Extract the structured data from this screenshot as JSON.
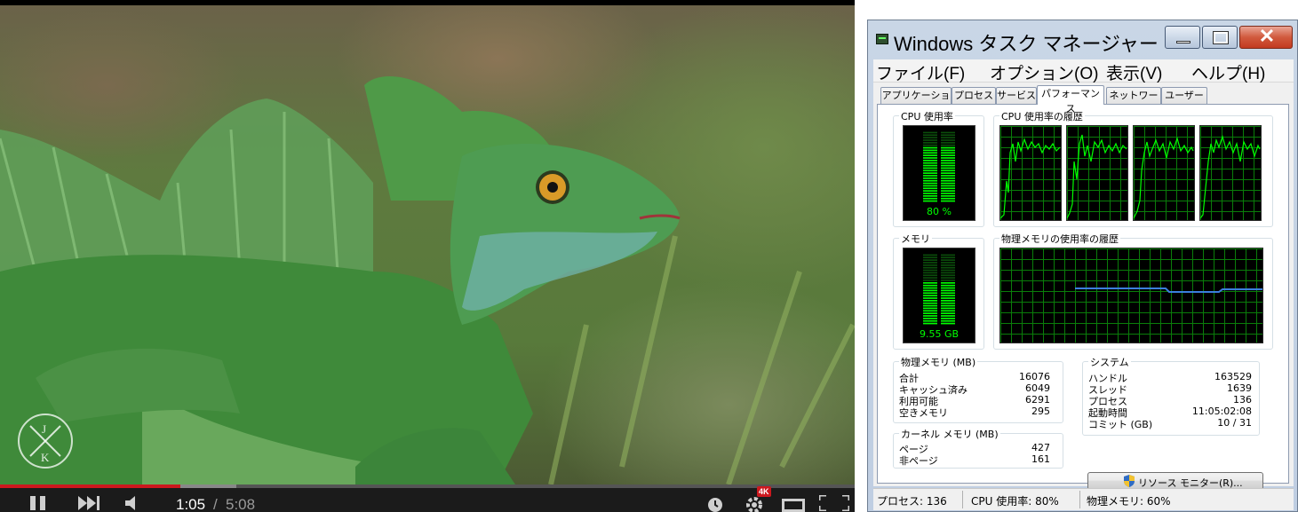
{
  "player": {
    "time_current": "1:05",
    "time_separator": "/",
    "time_total": "5:08",
    "played_fraction": 0.211,
    "buffered_fraction": 0.277,
    "hd_badge": "4K",
    "watermark_letters": "J K",
    "icons": [
      "play-pause-icon",
      "next-icon",
      "volume-icon",
      "watch-later-icon",
      "settings-gear-icon",
      "theater-mode-icon",
      "fullscreen-icon"
    ],
    "colors": {
      "progress": "#cc181e",
      "bar": "#1b1b1b"
    }
  },
  "task_manager": {
    "title": "Windows タスク マネージャー",
    "menu": [
      "ファイル(F)",
      "オプション(O)",
      "表示(V)",
      "ヘルプ(H)"
    ],
    "tabs": [
      "アプリケーション",
      "プロセス",
      "サービス",
      "パフォーマンス",
      "ネットワーク",
      "ユーザー"
    ],
    "active_tab": "パフォーマンス",
    "cpu_usage": {
      "label": "CPU 使用率",
      "value": "80 %",
      "percent": 80
    },
    "cpu_history": {
      "label": "CPU 使用率の履歴"
    },
    "memory": {
      "label": "メモリ",
      "value": "9.55 GB",
      "percent": 60
    },
    "memory_history": {
      "label": "物理メモリの使用率の履歴"
    },
    "physical_memory": {
      "label": "物理メモリ (MB)",
      "rows": [
        {
          "k": "合計",
          "v": "16076"
        },
        {
          "k": "キャッシュ済み",
          "v": "6049"
        },
        {
          "k": "利用可能",
          "v": "6291"
        },
        {
          "k": "空きメモリ",
          "v": "295"
        }
      ]
    },
    "kernel_memory": {
      "label": "カーネル メモリ (MB)",
      "rows": [
        {
          "k": "ページ",
          "v": "427"
        },
        {
          "k": "非ページ",
          "v": "161"
        }
      ]
    },
    "system": {
      "label": "システム",
      "rows": [
        {
          "k": "ハンドル",
          "v": "163529"
        },
        {
          "k": "スレッド",
          "v": "1639"
        },
        {
          "k": "プロセス",
          "v": "136"
        },
        {
          "k": "起動時間",
          "v": "11:05:02:08"
        },
        {
          "k": "コミット (GB)",
          "v": "10 / 31"
        }
      ]
    },
    "resource_monitor_button": "リソース モニター(R)...",
    "status": {
      "processes": "プロセス: 136",
      "cpu": "CPU 使用率: 80%",
      "memory": "物理メモリ: 60%"
    },
    "colors": {
      "meter": "#00ff00",
      "grid": "#0a7d0a",
      "memory_line": "#3b7fdc"
    }
  }
}
